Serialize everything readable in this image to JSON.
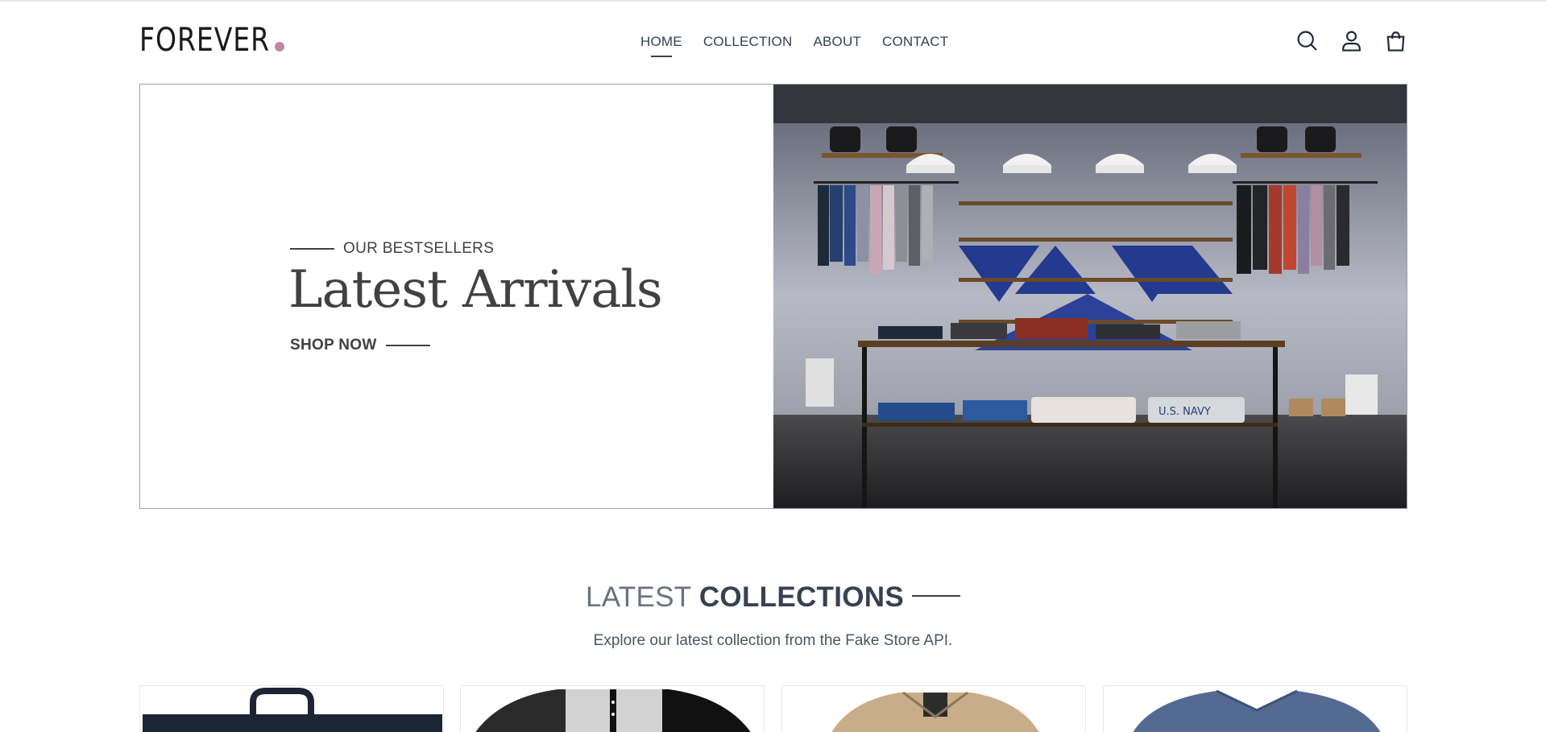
{
  "header": {
    "logo": "FOREVER",
    "nav": [
      "HOME",
      "COLLECTION",
      "ABOUT",
      "CONTACT"
    ],
    "active_nav": "HOME",
    "icons": [
      "search-icon",
      "user-icon",
      "cart-icon"
    ]
  },
  "hero": {
    "eyebrow": "OUR BESTSELLERS",
    "title": "Latest Arrivals",
    "cta": "SHOP NOW"
  },
  "collections": {
    "title_light": "LATEST",
    "title_bold": "COLLECTIONS",
    "subtitle": "Explore our latest collection from the Fake Store API."
  },
  "colors": {
    "text": "#374151",
    "logo_dot": "#c586a5",
    "hero_text": "#414141"
  }
}
